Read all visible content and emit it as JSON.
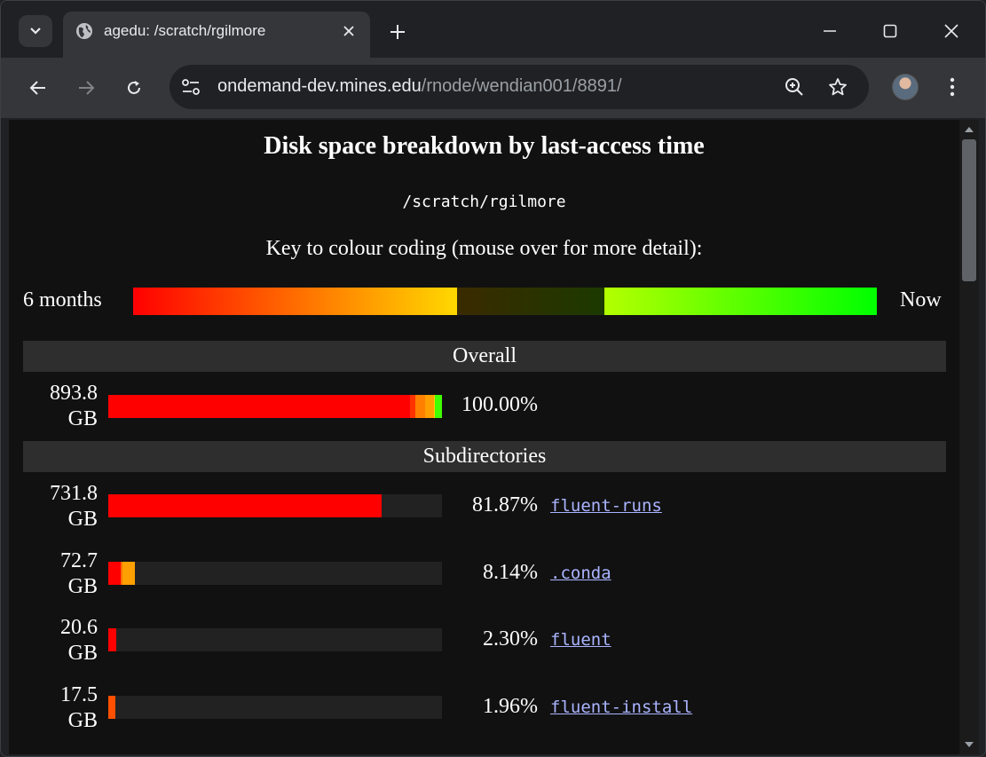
{
  "browser": {
    "tab_title": "agedu: /scratch/rgilmore",
    "url_host": "ondemand-dev.mines.edu",
    "url_path": "/rnode/wendian001/8891/"
  },
  "page": {
    "title": "Disk space breakdown by last-access time",
    "path": "/scratch/rgilmore",
    "key_caption": "Key to colour coding (mouse over for more detail):",
    "key_left": "6 months",
    "key_right": "Now",
    "key_segments": [
      {
        "fraction": 0.436,
        "gradient": [
          "#ff0000",
          "#ffd800"
        ]
      },
      {
        "fraction": 0.198,
        "gradient": [
          "#3a2a00",
          "#1c3a00"
        ]
      },
      {
        "fraction": 0.366,
        "gradient": [
          "#b4ff00",
          "#00ff00"
        ]
      }
    ]
  },
  "overall": {
    "heading": "Overall",
    "size_value": "893.8",
    "size_unit": "GB",
    "percent": "100.00%",
    "segments": [
      {
        "fraction": 0.904,
        "color": "#ff0000"
      },
      {
        "fraction": 0.016,
        "color": "#ff3300"
      },
      {
        "fraction": 0.03,
        "color": "#ff8000"
      },
      {
        "fraction": 0.027,
        "color": "#ffa000"
      },
      {
        "fraction": 0.003,
        "color": "#ffd000"
      },
      {
        "fraction": 0.02,
        "color": "#40ff00"
      }
    ]
  },
  "subdirectories": {
    "heading": "Subdirectories",
    "rows": [
      {
        "size_value": "731.8",
        "size_unit": "GB",
        "percent": "81.87%",
        "name": "fluent-runs",
        "segments": [
          {
            "fraction": 0.818,
            "color": "#ff0000"
          }
        ]
      },
      {
        "size_value": "72.7",
        "size_unit": "GB",
        "percent": "8.14%",
        "name": ".conda",
        "segments": [
          {
            "fraction": 0.037,
            "color": "#ff0000"
          },
          {
            "fraction": 0.005,
            "color": "#ff7000"
          },
          {
            "fraction": 0.039,
            "color": "#ffa000"
          }
        ]
      },
      {
        "size_value": "20.6",
        "size_unit": "GB",
        "percent": "2.30%",
        "name": "fluent",
        "segments": [
          {
            "fraction": 0.023,
            "color": "#ff0000"
          }
        ]
      },
      {
        "size_value": "17.5",
        "size_unit": "GB",
        "percent": "1.96%",
        "name": "fluent-install",
        "segments": [
          {
            "fraction": 0.02,
            "color": "#ff5000"
          }
        ]
      }
    ]
  }
}
